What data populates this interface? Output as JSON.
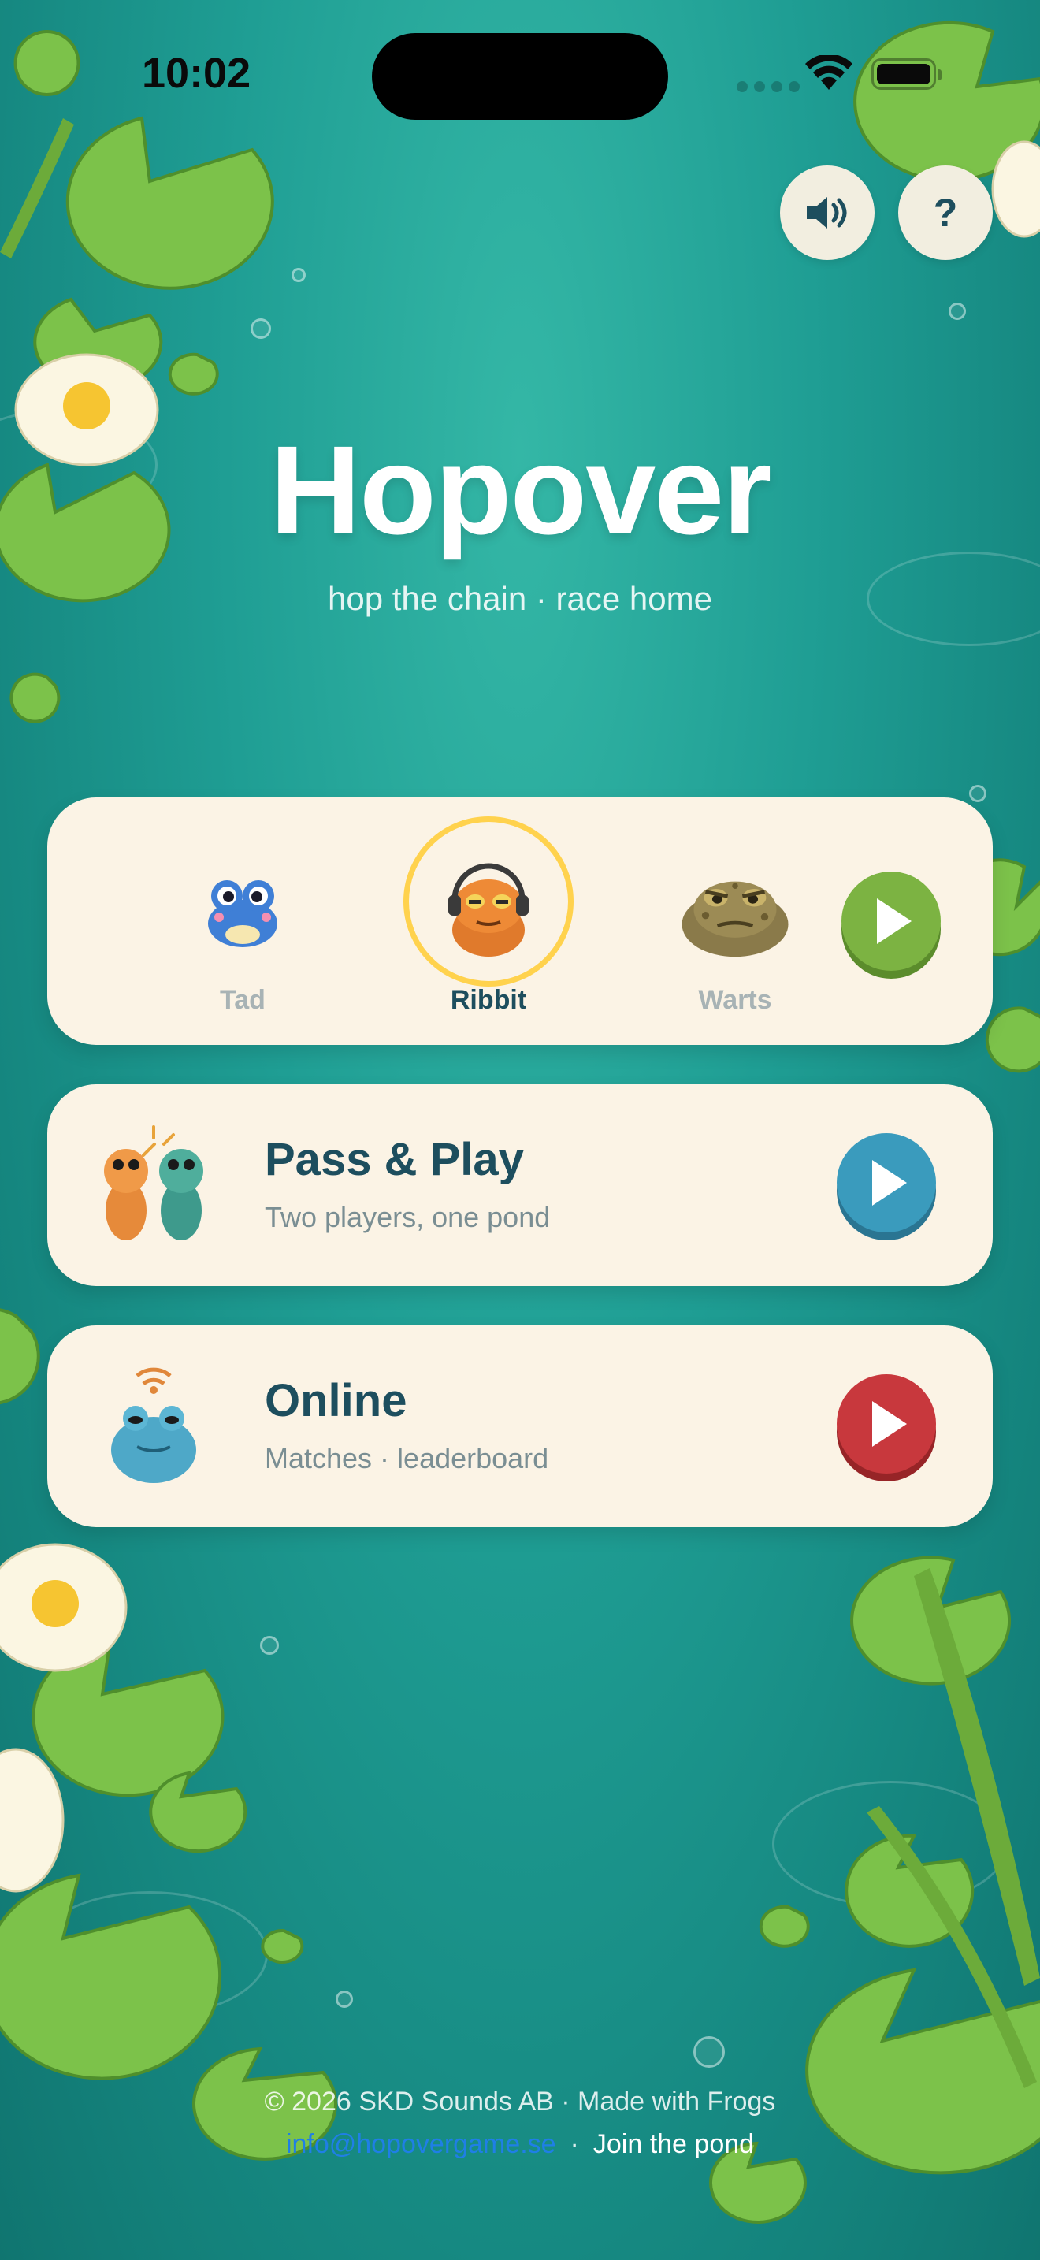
{
  "status_bar": {
    "time": "10:02"
  },
  "header": {
    "sound_icon": "speaker-icon",
    "help_label": "?"
  },
  "hero": {
    "title": "Hopover",
    "subtitle": "hop the chain · race home"
  },
  "characters": {
    "selected": "Ribbit",
    "items": [
      {
        "name": "Tad",
        "icon": "blue-frog-icon"
      },
      {
        "name": "Ribbit",
        "icon": "headphone-frog-icon"
      },
      {
        "name": "Warts",
        "icon": "toad-icon"
      }
    ],
    "play_icon": "play-icon"
  },
  "modes": [
    {
      "title": "Pass & Play",
      "subtitle": "Two players, one pond",
      "icon": "two-frogs-icon",
      "color": "#3a9bbd"
    },
    {
      "title": "Online",
      "subtitle": "Matches · leaderboard",
      "icon": "wifi-frog-icon",
      "color": "#c8383d"
    }
  ],
  "footer": {
    "copyright": "© 2026 SKD Sounds AB · Made with Frogs",
    "email": "info@hopovergame.se",
    "separator": "·",
    "join_label": "Join the pond"
  },
  "colors": {
    "pond": "#1f9e94",
    "card": "#fbf3e5",
    "text_dark": "#1d4e5e",
    "select_ring": "#ffd24d",
    "play_green": "#7cb342",
    "link": "#1f7fe6"
  }
}
